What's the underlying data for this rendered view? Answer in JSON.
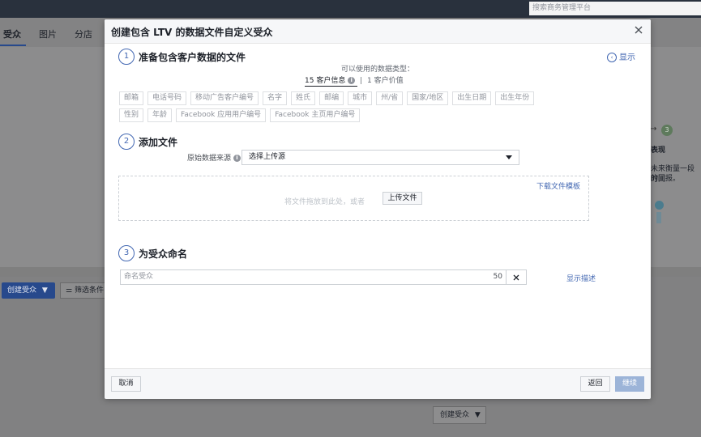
{
  "background": {
    "search_placeholder": "搜索商务管理平台",
    "tabs": [
      "受众",
      "图片",
      "分店"
    ],
    "create_audience_button": "创建受众",
    "filter_button": "筛选条件",
    "step3_label": "3",
    "right_text_1": "表现",
    "right_text_2": "未来衡量一段时间",
    "right_text_3": "的回报。",
    "bottom_create_button": "创建受众"
  },
  "modal": {
    "title": "创建包含 LTV 的数据文件自定义受众",
    "show_toggle": "显示",
    "step1": {
      "num": "1",
      "title": "准备包含客户数据的文件",
      "available_label": "可以使用的数据类型：",
      "tab_customer_info": "15 客户信息",
      "tab_customer_value": "1 客户价值",
      "separator": "|",
      "chips_row1": [
        "邮箱",
        "电话号码",
        "移动广告客户编号",
        "名字",
        "姓氏",
        "邮编",
        "城市",
        "州/省",
        "国家/地区",
        "出生日期",
        "出生年份"
      ],
      "chips_row2": [
        "性别",
        "年龄",
        "Facebook 应用用户编号",
        "Facebook 主页用户编号"
      ]
    },
    "step2": {
      "num": "2",
      "title": "添加文件",
      "source_label": "原始数据来源",
      "source_select": "选择上传源",
      "download_template": "下载文件模板",
      "drop_text": "将文件拖放到此处，或者",
      "upload_button": "上传文件"
    },
    "step3": {
      "num": "3",
      "title": "为受众命名",
      "name_placeholder": "命名受众",
      "char_count": "50",
      "show_description": "显示描述"
    },
    "footer": {
      "cancel": "取消",
      "back": "返回",
      "next": "继续"
    }
  }
}
